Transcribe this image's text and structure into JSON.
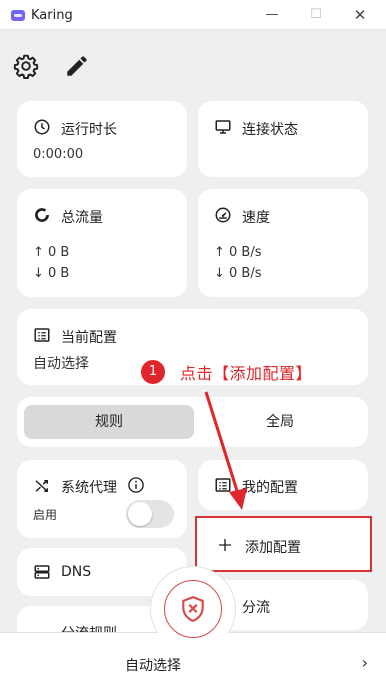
{
  "window": {
    "title": "Karing",
    "minimize": "—",
    "maximize": "☐",
    "close": "✕"
  },
  "toolbar": {
    "settings_icon": "gear-icon",
    "edit_icon": "pencil-icon"
  },
  "cards": {
    "runtime": {
      "title": "运行时长",
      "value": "0:00:00",
      "icon": "clock-icon"
    },
    "connection": {
      "title": "连接状态",
      "icon": "monitor-icon"
    },
    "traffic": {
      "title": "总流量",
      "up": "↑ 0 B",
      "down": "↓ 0 B",
      "icon": "donut-icon"
    },
    "speed": {
      "title": "速度",
      "up": "↑ 0 B/s",
      "down": "↓ 0 B/s",
      "icon": "speedometer-icon"
    },
    "current_config": {
      "title": "当前配置",
      "value": "自动选择",
      "icon": "list-icon"
    }
  },
  "mode": {
    "rule": "规则",
    "global": "全局",
    "selected": "规则"
  },
  "system_proxy": {
    "title": "系统代理",
    "status": "启用",
    "enabled": false,
    "info_icon": "info-icon",
    "icon": "shuffle-icon"
  },
  "my_config": {
    "title": "我的配置",
    "icon": "list-icon"
  },
  "add_config": {
    "title": "添加配置",
    "icon": "plus-icon"
  },
  "dns": {
    "title": "DNS",
    "icon": "server-icon"
  },
  "split": {
    "title": "分流"
  },
  "rules": {
    "title": "分流规则"
  },
  "annotation": {
    "step": "1",
    "text": "点击【添加配置】",
    "color": "#e0252b"
  },
  "bottom": {
    "label": "自动选择",
    "chevron": "›"
  },
  "center_button": {
    "icon": "shield-x-icon",
    "color": "#d64a4a"
  }
}
